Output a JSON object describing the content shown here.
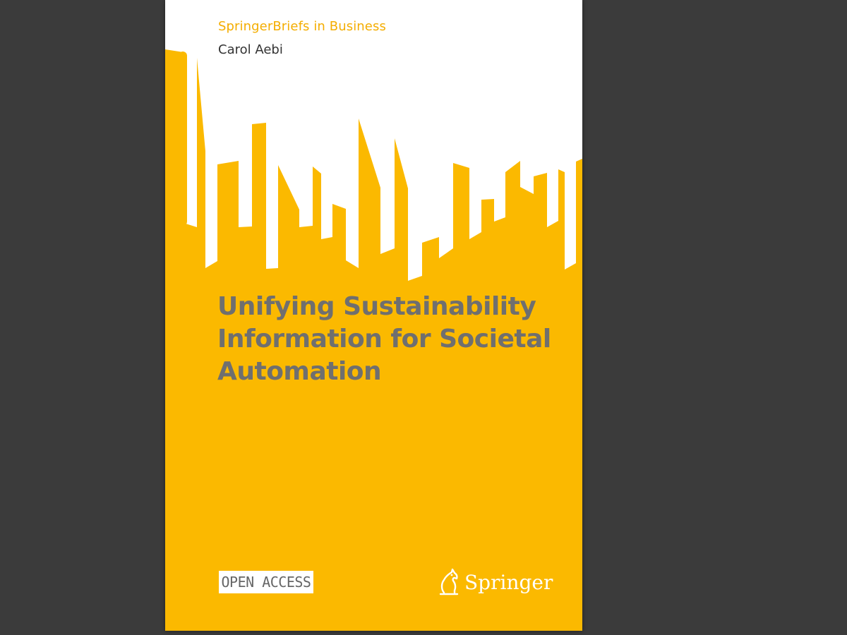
{
  "viewer": {
    "background": "#3b3b3b"
  },
  "cover": {
    "series": "SpringerBriefs in Business",
    "author": "Carol Aebi",
    "title_lines": [
      "Unifying Sustainability",
      "Information for Societal",
      "Automation"
    ],
    "badge": "OPEN ACCESS",
    "publisher": "Springer",
    "publisher_logo_icon": "springer-horse-icon",
    "colors": {
      "background": "#fbb900",
      "title": "#6f6f6f",
      "series": "#f4ad00",
      "author": "#333333"
    }
  }
}
